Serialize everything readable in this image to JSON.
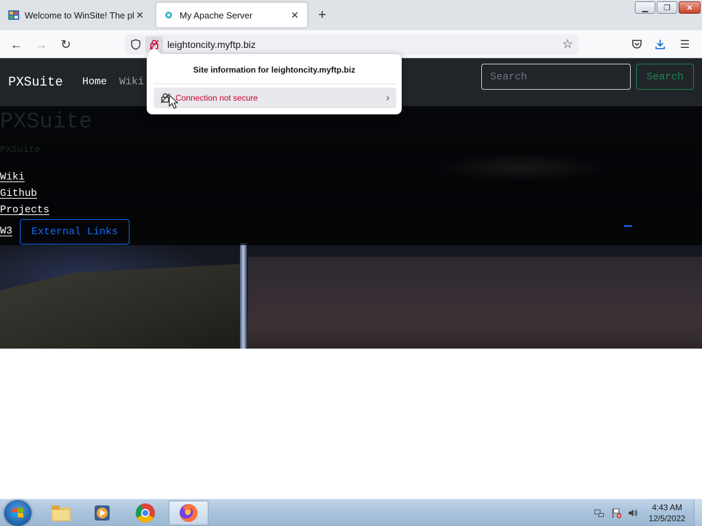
{
  "browser": {
    "tabs": [
      {
        "title": "Welcome to WinSite! The place",
        "icon": "winsite-favicon-icon"
      },
      {
        "title": "My Apache Server",
        "icon": "apache-favicon-icon"
      }
    ],
    "url": "leightoncity.myftp.biz"
  },
  "site": {
    "brand": "PXSuite",
    "nav": {
      "home": "Home",
      "wiki": "Wiki"
    },
    "search": {
      "placeholder": "Search",
      "button": "Search"
    },
    "hero": {
      "title": "PXSuite",
      "subtitle": "PXSuite",
      "links": [
        "Wiki",
        "Github",
        "Projects",
        "W3"
      ],
      "external_button": "External Links"
    }
  },
  "popup": {
    "title": "Site information for leightoncity.myftp.biz",
    "connection": "Connection not secure"
  },
  "taskbar": {
    "time": "4:43 AM",
    "date": "12/5/2022"
  },
  "colors": {
    "navbar_bg": "#212529",
    "search_btn": "#198754",
    "external_btn": "#0d6efd",
    "insecure_text": "#c5002f"
  }
}
